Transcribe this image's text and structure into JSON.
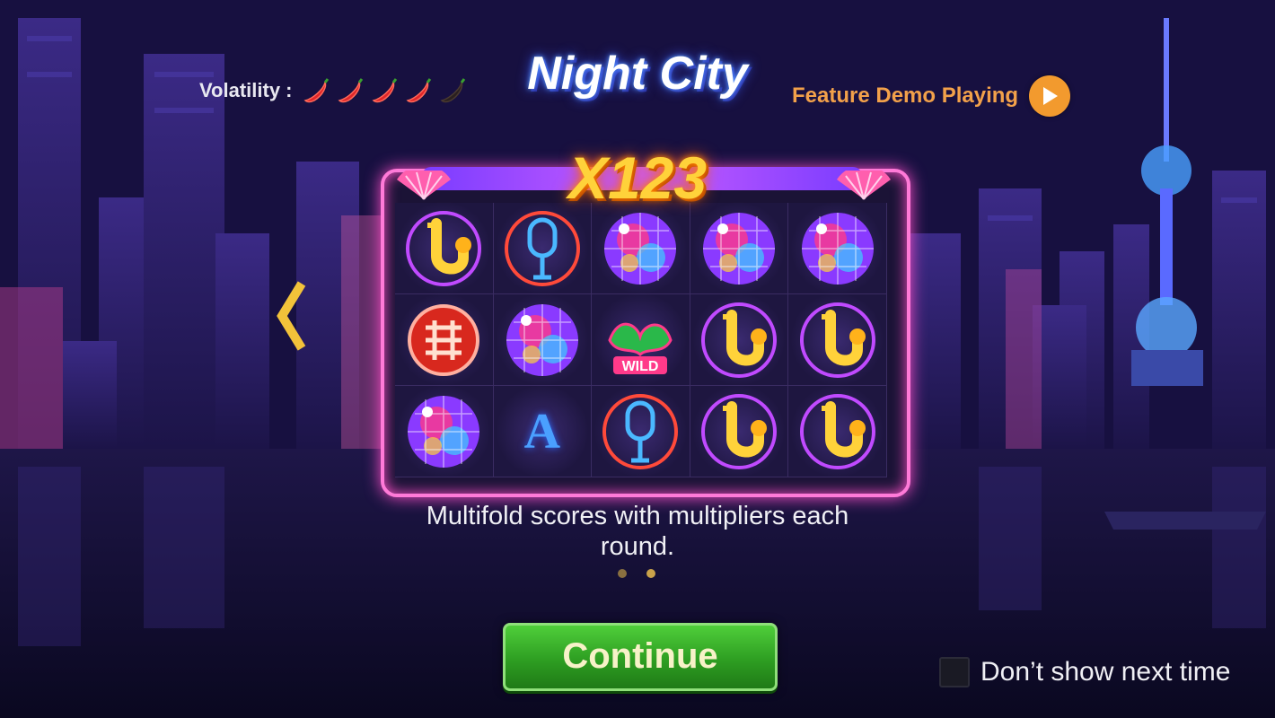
{
  "header": {
    "volatility_label": "Volatility :",
    "volatility_level": 4,
    "volatility_max": 5,
    "title": "Night City",
    "feature_demo_label": "Feature Demo Playing"
  },
  "feature": {
    "multiplier": "X123",
    "reel_symbols": [
      [
        "saxophone",
        "microphone",
        "disco-ball",
        "disco-ball",
        "disco-ball"
      ],
      [
        "fortune-tile",
        "disco-ball",
        "wild-dragon",
        "saxophone",
        "saxophone"
      ],
      [
        "disco-ball",
        "letter-a",
        "microphone",
        "saxophone",
        "saxophone"
      ]
    ],
    "wild_text": "WILD",
    "letter_symbol": "A",
    "description": "Multifold scores with multipliers each round.",
    "page_index": 2,
    "page_count": 2
  },
  "footer": {
    "continue_label": "Continue",
    "dont_show_label": "Don’t show next time",
    "dont_show_checked": false
  },
  "colors": {
    "title_glow": "#3b5bff",
    "feature_demo": "#f2a14a",
    "multiplier": "#ffd23a",
    "continue_button": "#2e9e22",
    "frame_neon": "#ff7ad8"
  }
}
